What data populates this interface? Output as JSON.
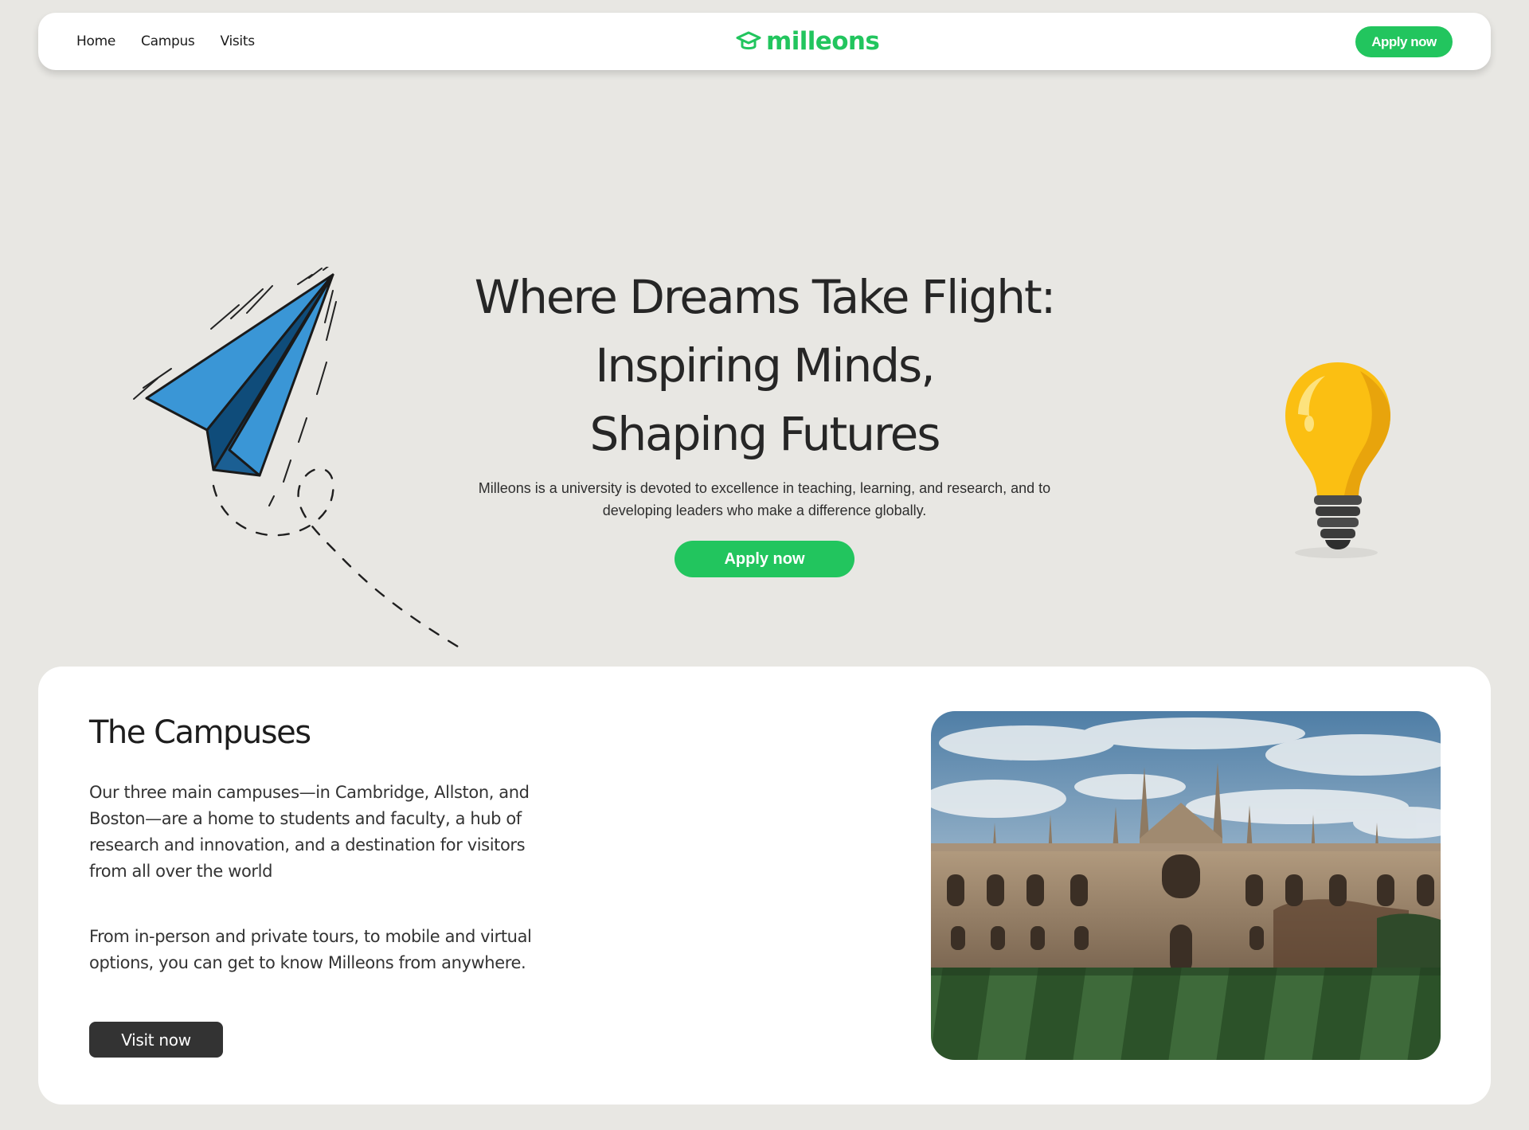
{
  "nav": {
    "links": [
      "Home",
      "Campus",
      "Visits"
    ],
    "logo_text": "milleons",
    "logo_icon": "graduation-cap-icon",
    "apply_label": "Apply now"
  },
  "hero": {
    "title_lines": [
      "Where Dreams Take Flight:",
      "Inspiring Minds,",
      "Shaping Futures"
    ],
    "description": "Milleons is a university is devoted to excellence in teaching, learning, and research, and to developing leaders who make a difference globally.",
    "apply_label": "Apply now",
    "illustrations": [
      "paper-plane-icon",
      "light-bulb-icon"
    ]
  },
  "campus": {
    "title": "The Campuses",
    "paragraph1": "Our three main campuses—in Cambridge, Allston, and Boston—are a home to students and faculty, a hub of research and innovation, and a destination for visitors from all over the world",
    "paragraph2": "From in-person and private tours, to mobile and virtual options, you can get to know Milleons from anywhere.",
    "visit_label": "Visit now",
    "photo": "campus-building-photo"
  },
  "colors": {
    "accent": "#22c55e",
    "background": "#e8e7e3",
    "card": "#ffffff",
    "dark_button": "#333333",
    "text": "#262626"
  }
}
